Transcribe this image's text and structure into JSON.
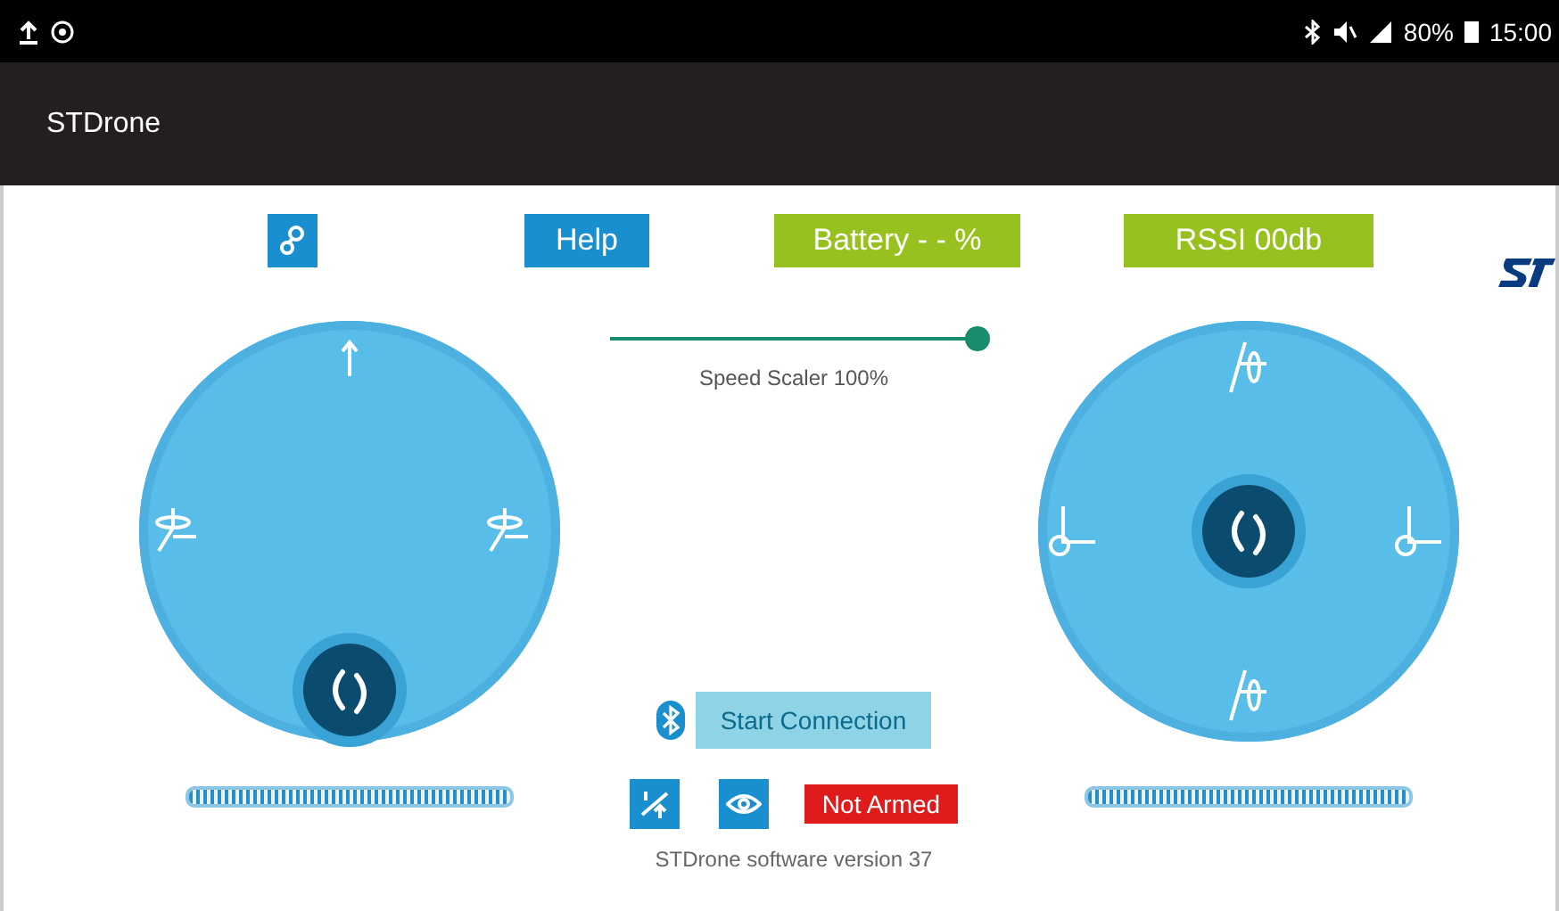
{
  "status_bar": {
    "battery": "80%",
    "time": "15:00"
  },
  "app_bar": {
    "title": "STDrone"
  },
  "top_bar": {
    "help": "Help",
    "battery": "Battery - - %",
    "rssi": "RSSI 00db"
  },
  "joysticks": [
    {
      "kind": "throttle",
      "level": 1.0
    },
    {
      "kind": "direction",
      "level": 1.0
    }
  ],
  "speed": {
    "level": 1.0,
    "label": "Speed Scaler 100%"
  },
  "connection": {
    "button": "Start Connection"
  },
  "arm": {
    "label": "Not Armed",
    "armed": false
  },
  "version": "STDrone software version 37"
}
